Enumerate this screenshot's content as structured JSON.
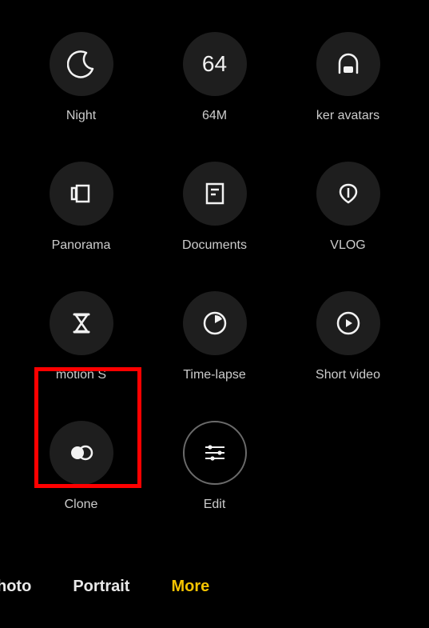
{
  "modes": {
    "night": {
      "label": "Night"
    },
    "sixtyfour": {
      "label": "64M",
      "glyph": "64"
    },
    "avatars": {
      "label": "ker avatars"
    },
    "panorama": {
      "label": "Panorama"
    },
    "documents": {
      "label": "Documents"
    },
    "vlog": {
      "label": "VLOG"
    },
    "slowmotion": {
      "label": "motion    S"
    },
    "timelapse": {
      "label": "Time-lapse"
    },
    "shortvideo": {
      "label": "Short video"
    },
    "clone": {
      "label": "Clone"
    },
    "edit": {
      "label": "Edit"
    }
  },
  "tabs": {
    "photo": {
      "label": "hoto",
      "active": false
    },
    "portrait": {
      "label": "Portrait",
      "active": false
    },
    "more": {
      "label": "More",
      "active": true
    }
  },
  "highlight": {
    "target": "clone"
  },
  "colors": {
    "accent": "#f5c400",
    "highlight": "#ff0000"
  }
}
